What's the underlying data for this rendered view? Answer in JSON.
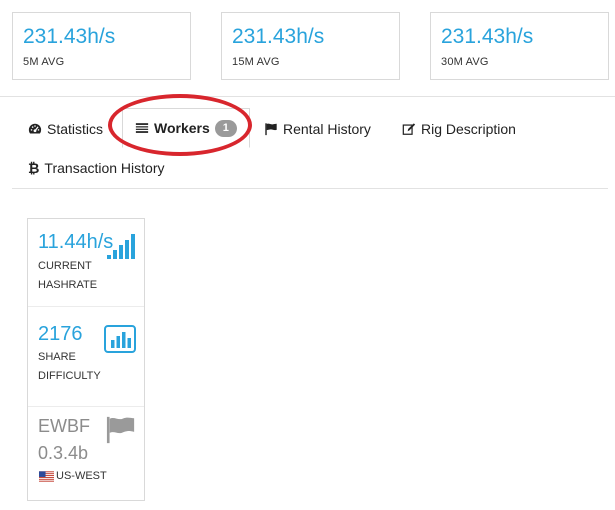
{
  "stats": [
    {
      "value": "231.43h/s",
      "label": "5M AVG"
    },
    {
      "value": "231.43h/s",
      "label": "15M AVG"
    },
    {
      "value": "231.43h/s",
      "label": "30M AVG"
    }
  ],
  "tabs": {
    "statistics": "Statistics",
    "workers": "Workers",
    "workers_count": "1",
    "rental_history": "Rental History",
    "rig_description": "Rig Description",
    "transaction_history": "Transaction History"
  },
  "worker": {
    "hashrate_value": "11.44h/s",
    "hashrate_label_line1": "CURRENT",
    "hashrate_label_line2": "HASHRATE",
    "difficulty_value": "2176",
    "difficulty_label_line1": "SHARE",
    "difficulty_label_line2": "DIFFICULTY",
    "software_line1": "EWBF",
    "software_line2": "0.3.4b",
    "region": "US-WEST"
  },
  "colors": {
    "accent": "#29a3dc",
    "annotation": "#d8262d",
    "badge": "#9a9a9a",
    "muted": "#8c8c8c"
  },
  "icons": {
    "statistics": "dashboard-icon",
    "workers": "list-icon",
    "rental_history": "flag-icon",
    "rig_description": "edit-icon",
    "transaction_history": "bitcoin-icon",
    "hashrate": "signal-bars-icon",
    "difficulty": "bar-chart-icon",
    "software": "flag-icon",
    "region": "us-flag-icon"
  }
}
